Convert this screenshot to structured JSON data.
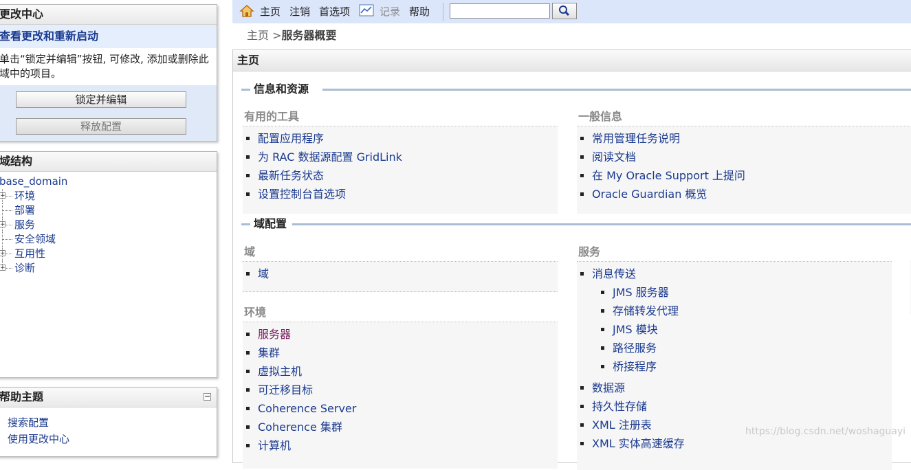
{
  "change_center": {
    "title": "更改中心",
    "subtitle": "查看更改和重新启动",
    "description": "单击“锁定并编辑”按钮, 可修改, 添加或删除此域中的项目。",
    "lock_button": "锁定并编辑",
    "release_button": "释放配置"
  },
  "domain_structure": {
    "title": "域结构",
    "root": "base_domain",
    "items": [
      {
        "label": "环境",
        "expandable": true
      },
      {
        "label": "部署",
        "expandable": false
      },
      {
        "label": "服务",
        "expandable": true
      },
      {
        "label": "安全领域",
        "expandable": false
      },
      {
        "label": "互用性",
        "expandable": true
      },
      {
        "label": "诊断",
        "expandable": true
      }
    ]
  },
  "help_topics": {
    "title": "帮助主题",
    "links": [
      "搜索配置",
      "使用更改中心"
    ]
  },
  "toolbar": {
    "home": "主页",
    "logout": "注销",
    "preferences": "首选项",
    "record": "记录",
    "help": "帮助",
    "search_value": ""
  },
  "breadcrumb": {
    "home": "主页",
    "separator": ">",
    "current": "服务器概要"
  },
  "main": {
    "title": "主页",
    "info_section": {
      "heading": "信息和资源",
      "tools": {
        "title": "有用的工具",
        "links": [
          "配置应用程序",
          "为 RAC 数据源配置 GridLink",
          "最新任务状态",
          "设置控制台首选项"
        ]
      },
      "general": {
        "title": "一般信息",
        "links": [
          "常用管理任务说明",
          "阅读文档",
          "在 My Oracle Support 上提问",
          "Oracle Guardian 概览"
        ]
      }
    },
    "domain_section": {
      "heading": "域配置",
      "domain": {
        "title": "域",
        "links": [
          "域"
        ]
      },
      "environment": {
        "title": "环境",
        "links": [
          "服务器",
          "集群",
          "虚拟主机",
          "可迁移目标",
          "Coherence Server",
          "Coherence 集群",
          "计算机"
        ]
      },
      "services": {
        "title": "服务",
        "messaging": "消息传送",
        "messaging_links": [
          "JMS 服务器",
          "存储转发代理",
          "JMS 模块",
          "路径服务",
          "桥接程序"
        ],
        "links": [
          "数据源",
          "持久性存储",
          "XML 注册表",
          "XML 实体高速缓存"
        ]
      }
    }
  },
  "watermark": "https://blog.csdn.net/woshaguayi",
  "colors": {
    "toolbar_bg": "#dbe6fb",
    "link": "#1a3a8f",
    "section_rule": "#a9bdd6"
  }
}
